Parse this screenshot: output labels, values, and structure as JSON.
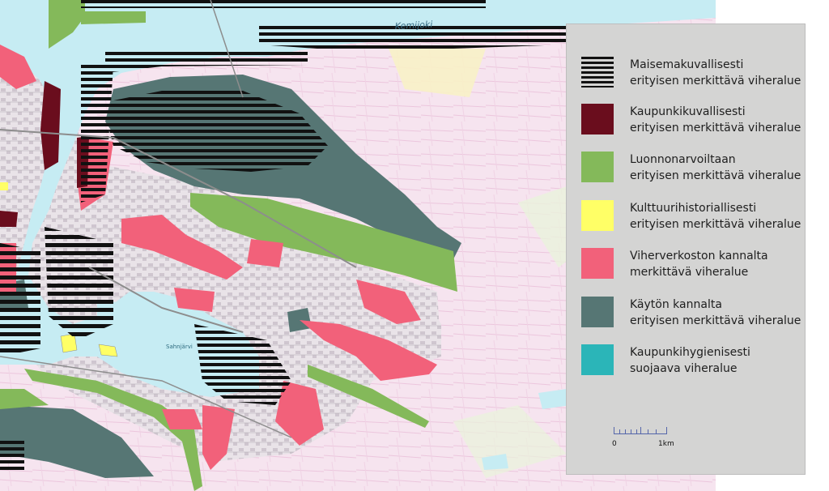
{
  "map": {
    "place_labels": {
      "river": "Kemijoki",
      "lake": "Sahnjärvi"
    }
  },
  "legend": {
    "items": [
      {
        "line1": "Maisemakuvallisesti",
        "line2": "erityisen merkittävä viheralue",
        "color": "#111111",
        "pattern": "stripes"
      },
      {
        "line1": "Kaupunkikuvallisesti",
        "line2": "erityisen merkittävä viheralue",
        "color": "#6a0d1d",
        "pattern": "solid"
      },
      {
        "line1": "Luonnonarvoiltaan",
        "line2": "erityisen merkittävä viheralue",
        "color": "#84b95a",
        "pattern": "solid"
      },
      {
        "line1": "Kulttuurihistoriallisesti",
        "line2": "erityisen merkittävä viheralue",
        "color": "#ffff66",
        "pattern": "solid"
      },
      {
        "line1": "Viherverkoston kannalta",
        "line2": "merkittävä viheralue",
        "color": "#f2617a",
        "pattern": "solid"
      },
      {
        "line1": "Käytön kannalta",
        "line2": "erityisen merkittävä viheralue",
        "color": "#567674",
        "pattern": "solid"
      },
      {
        "line1": "Kaupunkihygienisesti",
        "line2": "suojaava viheralue",
        "color": "#2bb5b8",
        "pattern": "solid"
      }
    ],
    "scale": {
      "start": "0",
      "end": "1km"
    }
  },
  "colors": {
    "water": "#c6ecf3",
    "land": "#f6e3ef",
    "urban": "#dcd6dc",
    "pink": "#f2617a",
    "darkred": "#6a0d1d",
    "green": "#84b95a",
    "yellow": "#ffff66",
    "teal_dark": "#567674"
  }
}
